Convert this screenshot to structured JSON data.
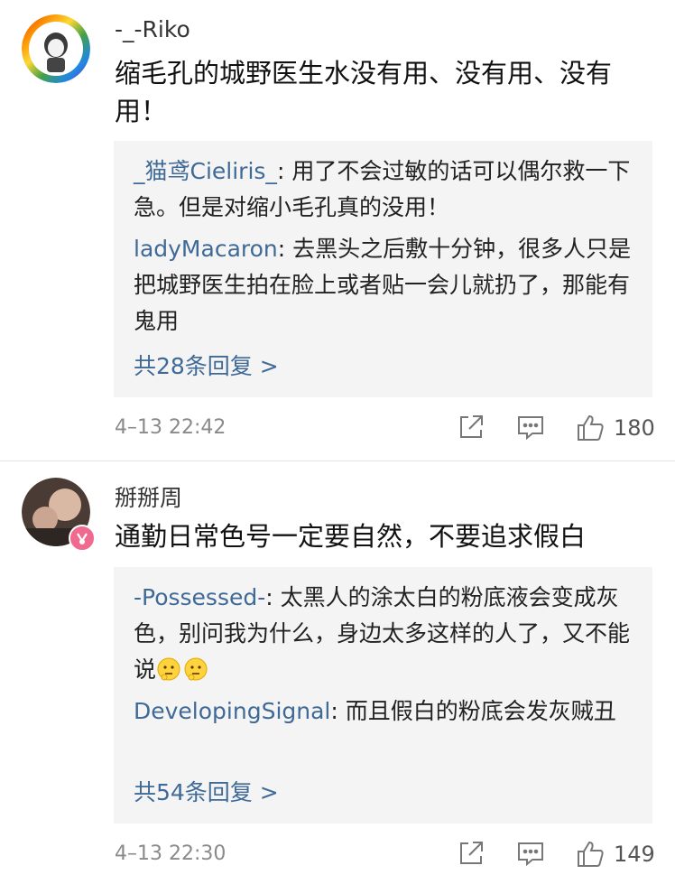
{
  "comments": [
    {
      "username": "-_-Riko",
      "text": "缩毛孔的城野医生水没有用、没有用、没有用！",
      "replies": [
        {
          "name": "_猫鸢Cieliris_",
          "text": "用了不会过敏的话可以偶尔救一下急。但是对缩小毛孔真的没用！"
        },
        {
          "name": "ladyMacaron",
          "text": "去黑头之后敷十分钟，很多人只是把城野医生拍在脸上或者贴一会儿就扔了，那能有鬼用"
        }
      ],
      "more_replies": "共28条回复 >",
      "time": "4–13 22:42",
      "likes": "180"
    },
    {
      "username": "掰掰周",
      "text": "通勤日常色号一定要自然，不要追求假白",
      "replies": [
        {
          "name": "-Possessed-",
          "text": "太黑人的涂太白的粉底液会变成灰色，别问我为什么，身边太多这样的人了，又不能说"
        },
        {
          "name": "DevelopingSignal",
          "text": "而且假白的粉底会发灰贼丑"
        }
      ],
      "more_replies": "共54条回复 >",
      "time": "4–13 22:30",
      "likes": "149"
    }
  ],
  "icons": {
    "share": "share-icon",
    "comment": "comment-icon",
    "like": "thumbs-up-icon"
  },
  "colors": {
    "link": "#3f6a97",
    "reply_bg": "#f4f4f4",
    "meta": "#8a8a8a"
  }
}
